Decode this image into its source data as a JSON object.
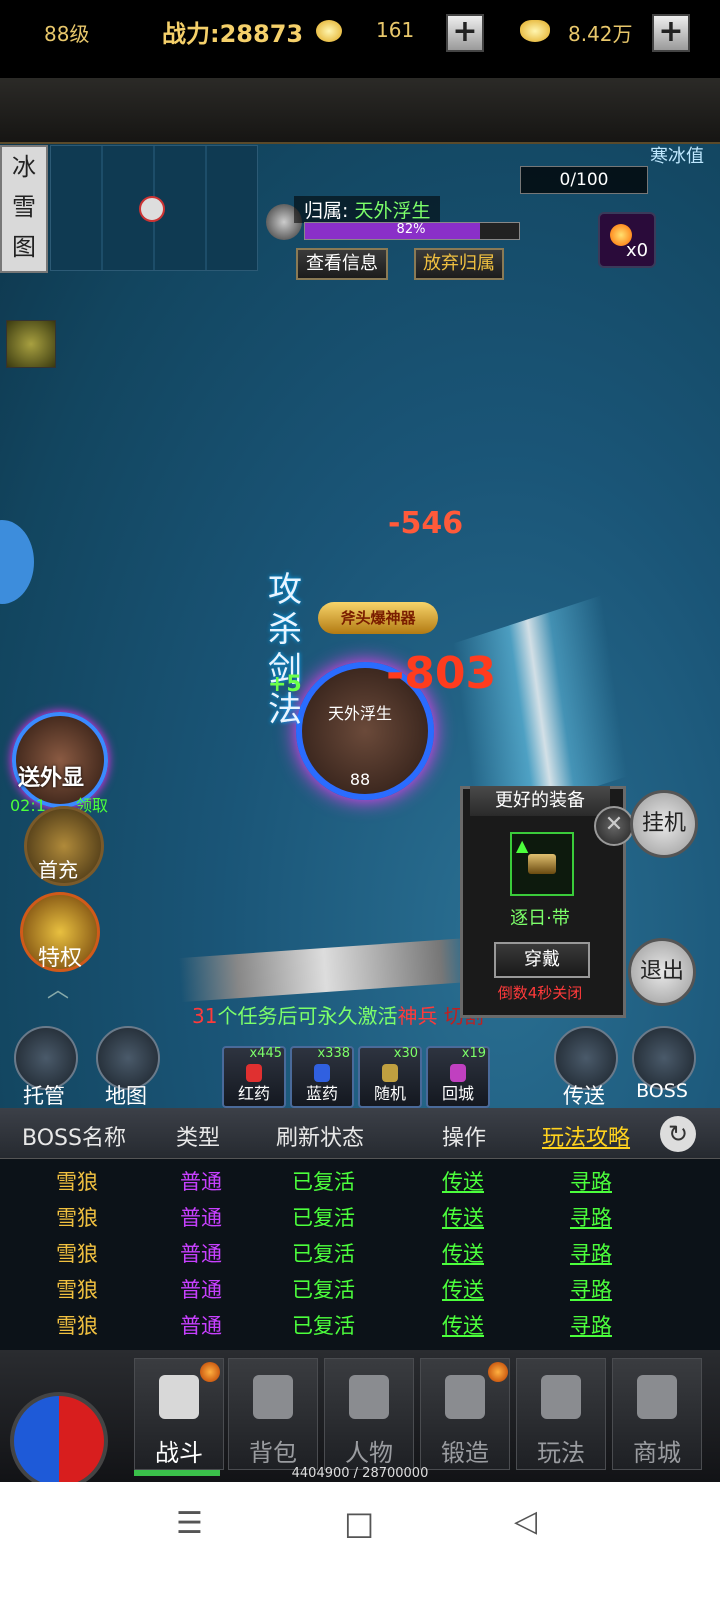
{
  "topbar": {
    "level": "88级",
    "power": "战力:28873",
    "gold": "161",
    "yuanbao": "8.42万",
    "plus": "+"
  },
  "map": {
    "tag": "冰雪图"
  },
  "owner": {
    "label": "归属:",
    "name": "天外浮生",
    "hp_percent": "82%",
    "hp_fraction": 0.82,
    "view_btn": "查看信息",
    "abandon_btn": "放弃归属"
  },
  "counter": "0/100",
  "frost_logo": "寒冰值",
  "item_count": "x0",
  "battle": {
    "damage1": "-546",
    "damage2": "-803",
    "skill": "攻杀剑法",
    "heal": "+5",
    "banner": "斧头爆神器",
    "hero_name": "天外浮生",
    "hero_level": "88"
  },
  "left": {
    "gift": "送外显",
    "timer": "02:1",
    "timer_suffix": "领取",
    "first_charge": "首充",
    "privilege": "特权"
  },
  "quest": {
    "num": "31",
    "mid": "个任务后可永久激活",
    "item": "神兵",
    "tail": "切割"
  },
  "equip": {
    "title": "更好的装备",
    "name": "逐日·带",
    "wear": "穿戴",
    "countdown": "倒数4秒关闭",
    "close": "✕"
  },
  "right": {
    "idle": "挂机",
    "exit": "退出"
  },
  "actions": {
    "auto": "托管",
    "map": "地图",
    "teleport": "传送",
    "boss": "BOSS"
  },
  "potions": [
    {
      "name": "红药",
      "count": "x445",
      "color": "#e03030"
    },
    {
      "name": "蓝药",
      "count": "x338",
      "color": "#3060e0"
    },
    {
      "name": "随机",
      "count": "x30",
      "color": "#c0a040"
    },
    {
      "name": "回城",
      "count": "x19",
      "color": "#c040c0"
    }
  ],
  "boss_table": {
    "headers": [
      "BOSS名称",
      "类型",
      "刷新状态",
      "操作",
      "玩法攻略"
    ],
    "rows": [
      [
        "雪狼",
        "普通",
        "已复活",
        "传送",
        "寻路"
      ],
      [
        "雪狼",
        "普通",
        "已复活",
        "传送",
        "寻路"
      ],
      [
        "雪狼",
        "普通",
        "已复活",
        "传送",
        "寻路"
      ],
      [
        "雪狼",
        "普通",
        "已复活",
        "传送",
        "寻路"
      ],
      [
        "雪狼",
        "普通",
        "已复活",
        "传送",
        "寻路"
      ]
    ]
  },
  "nav": [
    "战斗",
    "背包",
    "人物",
    "锻造",
    "玩法",
    "商城"
  ],
  "exp": "4404900 / 28700000",
  "sysnav": {
    "menu": "☰",
    "home": "□",
    "back": "◁"
  }
}
